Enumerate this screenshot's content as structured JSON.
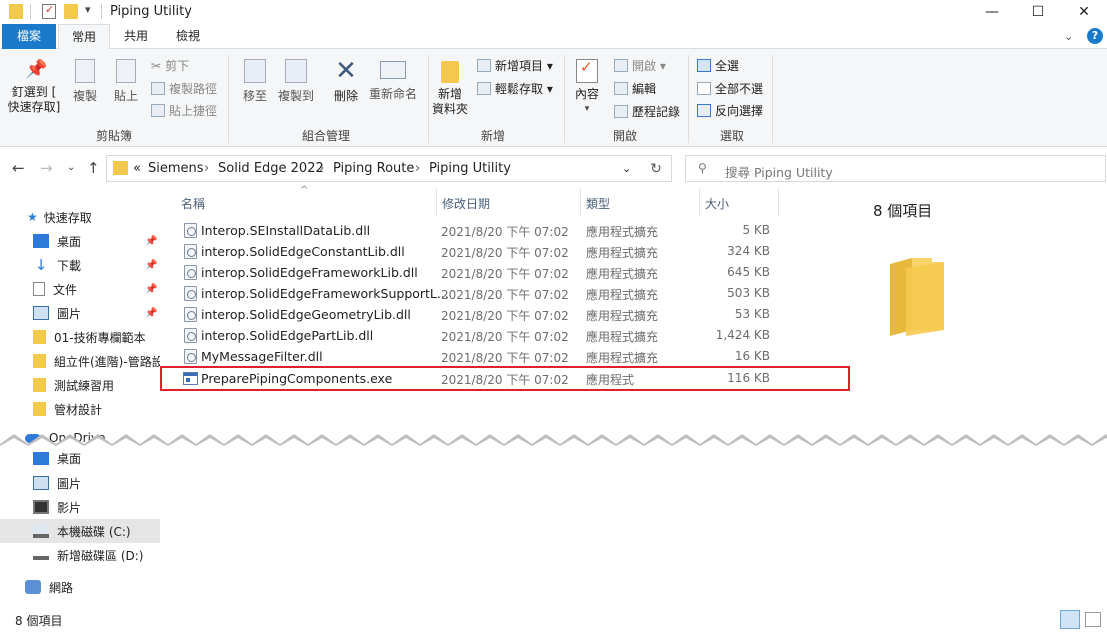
{
  "window": {
    "title": "Piping Utility",
    "minimize_glyph": "—",
    "maximize_glyph": "☐",
    "close_glyph": "✕"
  },
  "ribbon_tabs": [
    {
      "label": "檔案"
    },
    {
      "label": "常用"
    },
    {
      "label": "共用"
    },
    {
      "label": "檢視"
    }
  ],
  "ribbon": {
    "clipboard": {
      "pin_label_1": "釘選到 [",
      "pin_label_2": "快速存取]",
      "copy": "複製",
      "paste": "貼上",
      "cut": "剪下",
      "copy_path": "複製路徑",
      "paste_shortcut": "貼上捷徑",
      "group": "剪貼簿"
    },
    "organize": {
      "move_to": "移至",
      "copy_to": "複製到",
      "delete": "刪除",
      "rename": "重新命名",
      "group": "組合管理"
    },
    "new": {
      "new_folder_1": "新增",
      "new_folder_2": "資料夾",
      "new_item": "新增項目 ▾",
      "easy_access": "輕鬆存取 ▾",
      "group": "新增"
    },
    "open": {
      "properties": "內容",
      "open": "開啟 ▾",
      "edit": "編輯",
      "history": "歷程記錄",
      "group": "開啟"
    },
    "select": {
      "select_all": "全選",
      "select_none": "全部不選",
      "invert": "反向選擇",
      "group": "選取"
    }
  },
  "address": {
    "overflow": "«",
    "crumbs": [
      "Siemens",
      "Solid Edge 2022",
      "Piping Route",
      "Piping Utility"
    ],
    "search_placeholder": "搜尋 Piping Utility"
  },
  "nav_pane": {
    "quick_access": "快速存取",
    "items": [
      {
        "label": "桌面"
      },
      {
        "label": "下載"
      },
      {
        "label": "文件"
      },
      {
        "label": "圖片"
      },
      {
        "label": "01-技術專欄範本"
      },
      {
        "label": "組立件(進階)-管路設"
      },
      {
        "label": "測試練習用"
      },
      {
        "label": "管材設計"
      }
    ],
    "onedrive": "OneDrive",
    "pc_items": [
      {
        "label": "桌面"
      },
      {
        "label": "圖片"
      },
      {
        "label": "影片"
      },
      {
        "label": "本機磁碟 (C:)"
      },
      {
        "label": "新增磁碟區 (D:)"
      }
    ],
    "network": "網路"
  },
  "columns": {
    "name": "名稱",
    "date": "修改日期",
    "type": "類型",
    "size": "大小"
  },
  "files": [
    {
      "name": "Interop.SEInstallDataLib.dll",
      "date": "2021/8/20 下午 07:02",
      "type": "應用程式擴充",
      "size": "5 KB"
    },
    {
      "name": "interop.SolidEdgeConstantLib.dll",
      "date": "2021/8/20 下午 07:02",
      "type": "應用程式擴充",
      "size": "324 KB"
    },
    {
      "name": "interop.SolidEdgeFrameworkLib.dll",
      "date": "2021/8/20 下午 07:02",
      "type": "應用程式擴充",
      "size": "645 KB"
    },
    {
      "name": "interop.SolidEdgeFrameworkSupportL...",
      "date": "2021/8/20 下午 07:02",
      "type": "應用程式擴充",
      "size": "503 KB"
    },
    {
      "name": "interop.SolidEdgeGeometryLib.dll",
      "date": "2021/8/20 下午 07:02",
      "type": "應用程式擴充",
      "size": "53 KB"
    },
    {
      "name": "interop.SolidEdgePartLib.dll",
      "date": "2021/8/20 下午 07:02",
      "type": "應用程式擴充",
      "size": "1,424 KB"
    },
    {
      "name": "MyMessageFilter.dll",
      "date": "2021/8/20 下午 07:02",
      "type": "應用程式擴充",
      "size": "16 KB"
    },
    {
      "name": "PreparePipingComponents.exe",
      "date": "2021/8/20 下午 07:02",
      "type": "應用程式",
      "size": "116 KB"
    }
  ],
  "preview": {
    "count": "8 個項目"
  },
  "status": {
    "count": "8 個項目"
  },
  "colors": {
    "accent": "#1979ca",
    "highlight": "#e0202a",
    "selection": "#cce8ff",
    "folder": "#f2c94c"
  }
}
